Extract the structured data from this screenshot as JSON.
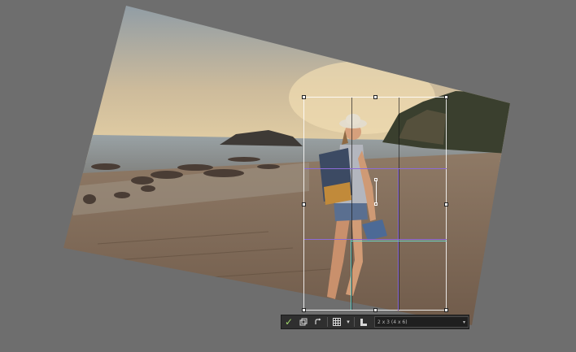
{
  "toolbar": {
    "commit_icon": "check-icon",
    "crop_ratio_value": "2 x 3 (4 x 6)",
    "dropdown_glyph": "▾"
  },
  "colors": {
    "background": "#6e6e6e",
    "commit": "#9fd46a",
    "guide_teal": "#6fd3c8",
    "guide_purple": "#8c6bd8"
  }
}
